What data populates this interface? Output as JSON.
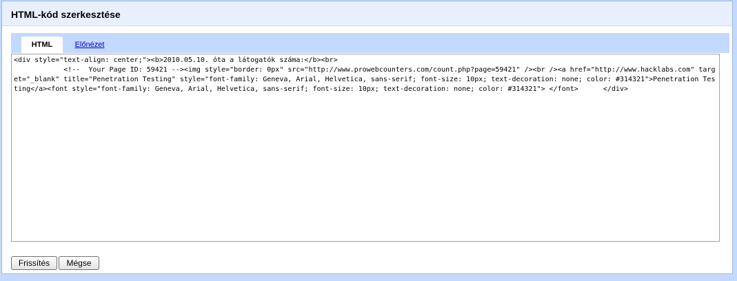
{
  "dialog": {
    "title": "HTML-kód szerkesztése"
  },
  "tabs": {
    "html_label": "HTML",
    "preview_label": "Előnézet"
  },
  "editor": {
    "content": "<div style=\"text-align: center;\"><b>2010.05.10. óta a látogatók száma:</b><br>\n            <!--  Your Page ID: 59421 --><img style=\"border: 0px\" src=\"http://www.prowebcounters.com/count.php?page=59421\" /><br /><a href=\"http://www.hacklabs.com\" target=\"_blank\" title=\"Penetration Testing\" style=\"font-family: Geneva, Arial, Helvetica, sans-serif; font-size: 10px; text-decoration: none; color: #314321\">Penetration Testing</a><font style=\"font-family: Geneva, Arial, Helvetica, sans-serif; font-size: 10px; text-decoration: none; color: #314321\"> </font>      </div>"
  },
  "buttons": {
    "refresh_label": "Frissítés",
    "cancel_label": "Mégse"
  }
}
